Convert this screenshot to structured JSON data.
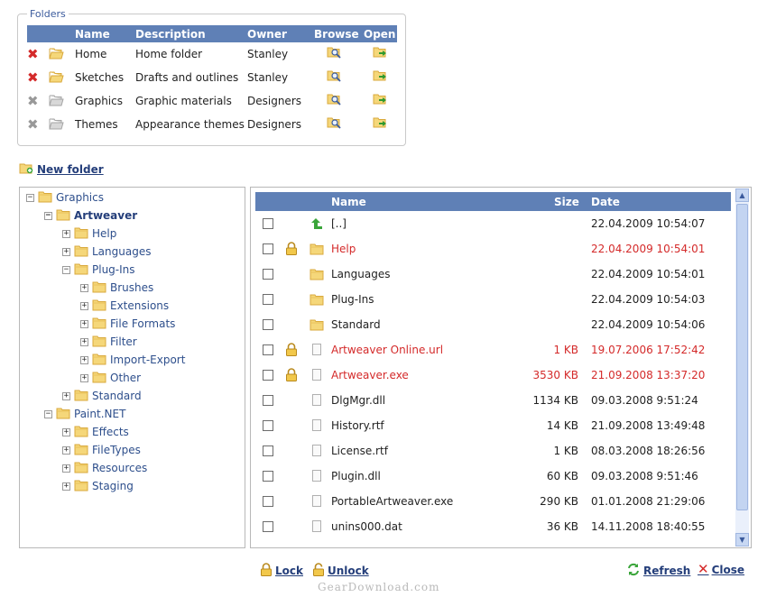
{
  "folders": {
    "legend": "Folders",
    "headers": {
      "name": "Name",
      "description": "Description",
      "owner": "Owner",
      "browse": "Browse",
      "open": "Open"
    },
    "rows": [
      {
        "name": "Home",
        "description": "Home folder",
        "owner": "Stanley",
        "deletable": true
      },
      {
        "name": "Sketches",
        "description": "Drafts and outlines",
        "owner": "Stanley",
        "deletable": true
      },
      {
        "name": "Graphics",
        "description": "Graphic materials",
        "owner": "Designers",
        "deletable": false
      },
      {
        "name": "Themes",
        "description": "Appearance themes",
        "owner": "Designers",
        "deletable": false
      }
    ]
  },
  "new_folder_label": "New folder",
  "tree": [
    {
      "label": "Graphics",
      "sign": "−",
      "level": 0,
      "bold": false
    },
    {
      "label": "Artweaver",
      "sign": "−",
      "level": 1,
      "bold": true
    },
    {
      "label": "Help",
      "sign": "+",
      "level": 2,
      "bold": false
    },
    {
      "label": "Languages",
      "sign": "+",
      "level": 2,
      "bold": false
    },
    {
      "label": "Plug-Ins",
      "sign": "−",
      "level": 2,
      "bold": false
    },
    {
      "label": "Brushes",
      "sign": "+",
      "level": 3,
      "bold": false
    },
    {
      "label": "Extensions",
      "sign": "+",
      "level": 3,
      "bold": false
    },
    {
      "label": "File Formats",
      "sign": "+",
      "level": 3,
      "bold": false
    },
    {
      "label": "Filter",
      "sign": "+",
      "level": 3,
      "bold": false
    },
    {
      "label": "Import-Export",
      "sign": "+",
      "level": 3,
      "bold": false
    },
    {
      "label": "Other",
      "sign": "+",
      "level": 3,
      "bold": false
    },
    {
      "label": "Standard",
      "sign": "+",
      "level": 2,
      "bold": false
    },
    {
      "label": "Paint.NET",
      "sign": "−",
      "level": 1,
      "bold": false
    },
    {
      "label": "Effects",
      "sign": "+",
      "level": 2,
      "bold": false
    },
    {
      "label": "FileTypes",
      "sign": "+",
      "level": 2,
      "bold": false
    },
    {
      "label": "Resources",
      "sign": "+",
      "level": 2,
      "bold": false
    },
    {
      "label": "Staging",
      "sign": "+",
      "level": 2,
      "bold": false
    }
  ],
  "files": {
    "headers": {
      "name": "Name",
      "size": "Size",
      "date": "Date"
    },
    "rows": [
      {
        "name": "[..]",
        "size": "",
        "date": "22.04.2009 10:54:07",
        "kind": "up",
        "locked": false,
        "red": false
      },
      {
        "name": "Help",
        "size": "",
        "date": "22.04.2009 10:54:01",
        "kind": "folder",
        "locked": true,
        "red": true
      },
      {
        "name": "Languages",
        "size": "",
        "date": "22.04.2009 10:54:01",
        "kind": "folder",
        "locked": false,
        "red": false
      },
      {
        "name": "Plug-Ins",
        "size": "",
        "date": "22.04.2009 10:54:03",
        "kind": "folder",
        "locked": false,
        "red": false
      },
      {
        "name": "Standard",
        "size": "",
        "date": "22.04.2009 10:54:06",
        "kind": "folder",
        "locked": false,
        "red": false
      },
      {
        "name": "Artweaver Online.url",
        "size": "1 KB",
        "date": "19.07.2006 17:52:42",
        "kind": "file",
        "locked": true,
        "red": true
      },
      {
        "name": "Artweaver.exe",
        "size": "3530 KB",
        "date": "21.09.2008 13:37:20",
        "kind": "file",
        "locked": true,
        "red": true
      },
      {
        "name": "DlgMgr.dll",
        "size": "1134 KB",
        "date": "09.03.2008 9:51:24",
        "kind": "file",
        "locked": false,
        "red": false
      },
      {
        "name": "History.rtf",
        "size": "14 KB",
        "date": "21.09.2008 13:49:48",
        "kind": "file",
        "locked": false,
        "red": false
      },
      {
        "name": "License.rtf",
        "size": "1 KB",
        "date": "08.03.2008 18:26:56",
        "kind": "file",
        "locked": false,
        "red": false
      },
      {
        "name": "Plugin.dll",
        "size": "60 KB",
        "date": "09.03.2008 9:51:46",
        "kind": "file",
        "locked": false,
        "red": false
      },
      {
        "name": "PortableArtweaver.exe",
        "size": "290 KB",
        "date": "01.01.2008 21:29:06",
        "kind": "file",
        "locked": false,
        "red": false
      },
      {
        "name": "unins000.dat",
        "size": "36 KB",
        "date": "14.11.2008 18:40:55",
        "kind": "file",
        "locked": false,
        "red": false
      }
    ]
  },
  "actions": {
    "lock": "Lock",
    "unlock": "Unlock",
    "refresh": "Refresh",
    "close": "Close"
  },
  "watermark": "GearDownload.com",
  "colors": {
    "header_bg": "#5f80b6",
    "link": "#243e7a",
    "tree_text": "#2e4f8c",
    "alert_red": "#d42a2a"
  }
}
